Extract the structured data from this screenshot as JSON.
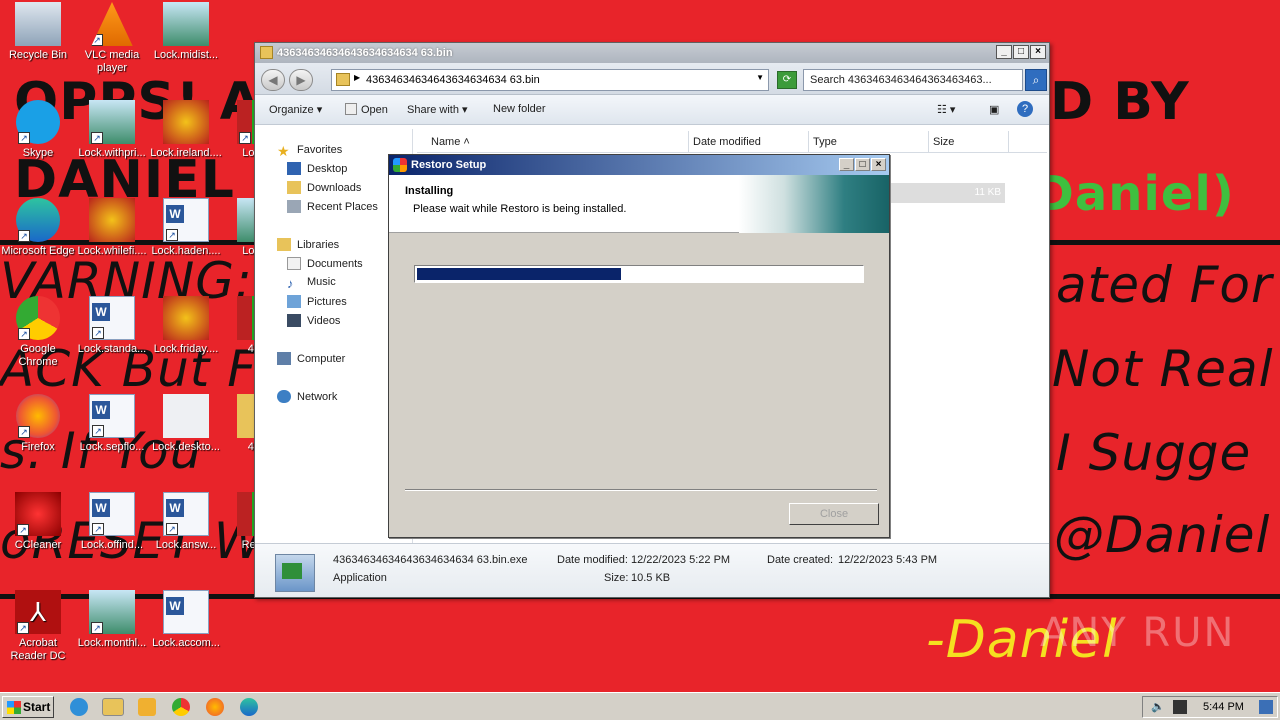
{
  "wallpaper": {
    "lines": [
      "OPPS! ALL",
      "D BY",
      "DANIEL",
      "Daniel)",
      "VARNING:",
      "ated For",
      "ACK But F",
      "Not Real",
      "s. If You",
      "I Sugge",
      "oRESET W",
      "@Daniel",
      "-Daniel"
    ]
  },
  "desktop_icons": [
    {
      "label": "Recycle Bin",
      "icon": "recycle-bin-icon"
    },
    {
      "label": "VLC media player",
      "icon": "vlc-icon"
    },
    {
      "label": "Lock.midist...",
      "icon": "image-file-icon"
    },
    {
      "label": "Skype",
      "icon": "skype-icon"
    },
    {
      "label": "Lock.withpri...",
      "icon": "image-file-icon"
    },
    {
      "label": "Lock.ireland....",
      "icon": "flower-image-icon"
    },
    {
      "label": "Lock....",
      "icon": "archive-icon"
    },
    {
      "label": "Microsoft Edge",
      "icon": "edge-icon"
    },
    {
      "label": "Lock.whilefi....",
      "icon": "flower-image-icon"
    },
    {
      "label": "Lock.haden....",
      "icon": "word-doc-icon"
    },
    {
      "label": "Lock....",
      "icon": "image-file-icon"
    },
    {
      "label": "Google Chrome",
      "icon": "chrome-icon"
    },
    {
      "label": "Lock.standa...",
      "icon": "word-doc-icon"
    },
    {
      "label": "Lock.friday....",
      "icon": "flower-image-icon"
    },
    {
      "label": "4363",
      "icon": "archive-icon"
    },
    {
      "label": "Firefox",
      "icon": "firefox-icon"
    },
    {
      "label": "Lock.sepflo...",
      "icon": "word-doc-icon"
    },
    {
      "label": "Lock.deskto...",
      "icon": "settings-file-icon"
    },
    {
      "label": "4363",
      "icon": "folder-icon"
    },
    {
      "label": "CCleaner",
      "icon": "ccleaner-icon"
    },
    {
      "label": "Lock.offind...",
      "icon": "word-doc-icon"
    },
    {
      "label": "Lock.answ...",
      "icon": "word-doc-icon"
    },
    {
      "label": "Re Res",
      "icon": "archive-icon"
    },
    {
      "label": "Acrobat Reader DC",
      "icon": "acrobat-icon"
    },
    {
      "label": "Lock.monthl...",
      "icon": "image-file-icon"
    },
    {
      "label": "Lock.accom...",
      "icon": "word-doc-icon"
    }
  ],
  "explorer": {
    "title": "43634634634643634634634 63.bin",
    "address": "43634634634643634634634 63.bin",
    "search_placeholder": "Search 4363463463464363463463...",
    "toolbar": {
      "organize": "Organize",
      "open": "Open",
      "share_with": "Share with",
      "new_folder": "New folder"
    },
    "nav": {
      "favorites": "Favorites",
      "desktop": "Desktop",
      "downloads": "Downloads",
      "recent_places": "Recent Places",
      "libraries": "Libraries",
      "documents": "Documents",
      "music": "Music",
      "pictures": "Pictures",
      "videos": "Videos",
      "computer": "Computer",
      "network": "Network"
    },
    "columns": {
      "name": "Name",
      "date_modified": "Date modified",
      "type": "Type",
      "size": "Size"
    },
    "row_size": "11 KB",
    "details": {
      "filename": "43634634634643634634634 63.bin.exe",
      "type": "Application",
      "date_modified_label": "Date modified:",
      "date_modified": "12/22/2023 5:22 PM",
      "date_created_label": "Date created:",
      "date_created": "12/22/2023 5:43 PM",
      "size_label": "Size:",
      "size": "10.5 KB"
    }
  },
  "setup": {
    "title": "Restoro Setup",
    "heading": "Installing",
    "subtitle": "Please wait while Restoro is being installed.",
    "progress": 0.46,
    "close_label": "Close"
  },
  "watermark": "ANY RUN",
  "taskbar": {
    "start_label": "Start",
    "clock": "5:44 PM"
  },
  "colors": {
    "wallpaper": "#e8242a",
    "progress": "#0a246a",
    "accent_green": "#3fbf3f"
  }
}
